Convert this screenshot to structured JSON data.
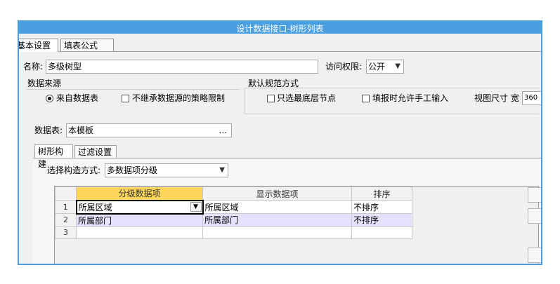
{
  "window": {
    "title": "设计数据接口-树形列表"
  },
  "tabs": [
    "基本设置",
    "填表公式"
  ],
  "name_label": "名称:",
  "name_value": "多级树型",
  "access_label": "访问权限:",
  "access_value": "公开",
  "datasource_group": "数据来源",
  "radio_from_table": "来自数据表",
  "chk_no_inherit": "不继承数据源的策略限制",
  "default_group": "默认规范方式",
  "chk_leaf_only": "只选最底层节点",
  "chk_manual": "填报时允许手工输入",
  "view_size_label": "视图尺寸 宽",
  "view_size_value": "360",
  "table_label": "数据表:",
  "table_value": "本模板",
  "table_browse": "...",
  "subtabs": [
    "树形构建",
    "过滤设置"
  ],
  "build_mode_label": "选择构造方式:",
  "build_mode_value": "多数据项分级",
  "grid": {
    "headers": [
      "分级数据项",
      "显示数据项",
      "排序"
    ],
    "rows": [
      {
        "n": "1",
        "level": "所属区域",
        "display": "所属区域",
        "sort": "不排序"
      },
      {
        "n": "2",
        "level": "所属部门",
        "display": "所属部门",
        "sort": "不排序"
      },
      {
        "n": "3",
        "level": "",
        "display": "",
        "sort": ""
      }
    ]
  }
}
